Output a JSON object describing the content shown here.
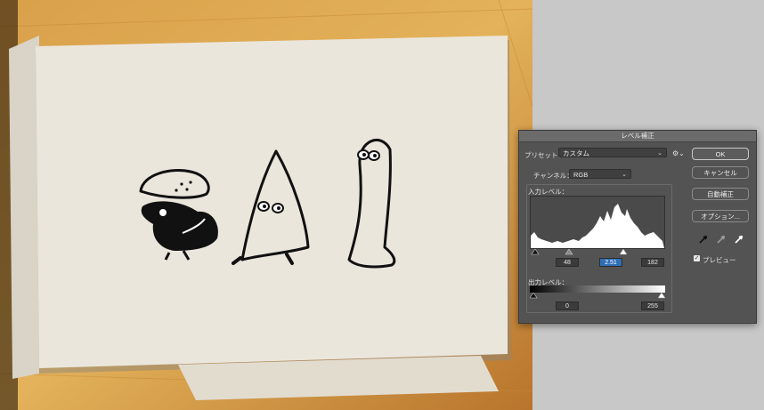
{
  "dialog": {
    "title": "レベル補正",
    "preset_label": "プリセット：",
    "preset_value": "カスタム",
    "channel_label": "チャンネル：",
    "channel_value": "RGB",
    "input_levels_label": "入力レベル：",
    "input_black": "48",
    "input_gamma": "2.51",
    "input_white": "182",
    "output_levels_label": "出力レベル：",
    "output_black": "0",
    "output_white": "255",
    "buttons": {
      "ok": "OK",
      "cancel": "キャンセル",
      "auto": "自動補正",
      "options": "オプション..."
    },
    "preview_label": "プレビュー",
    "preview_checked": true
  }
}
